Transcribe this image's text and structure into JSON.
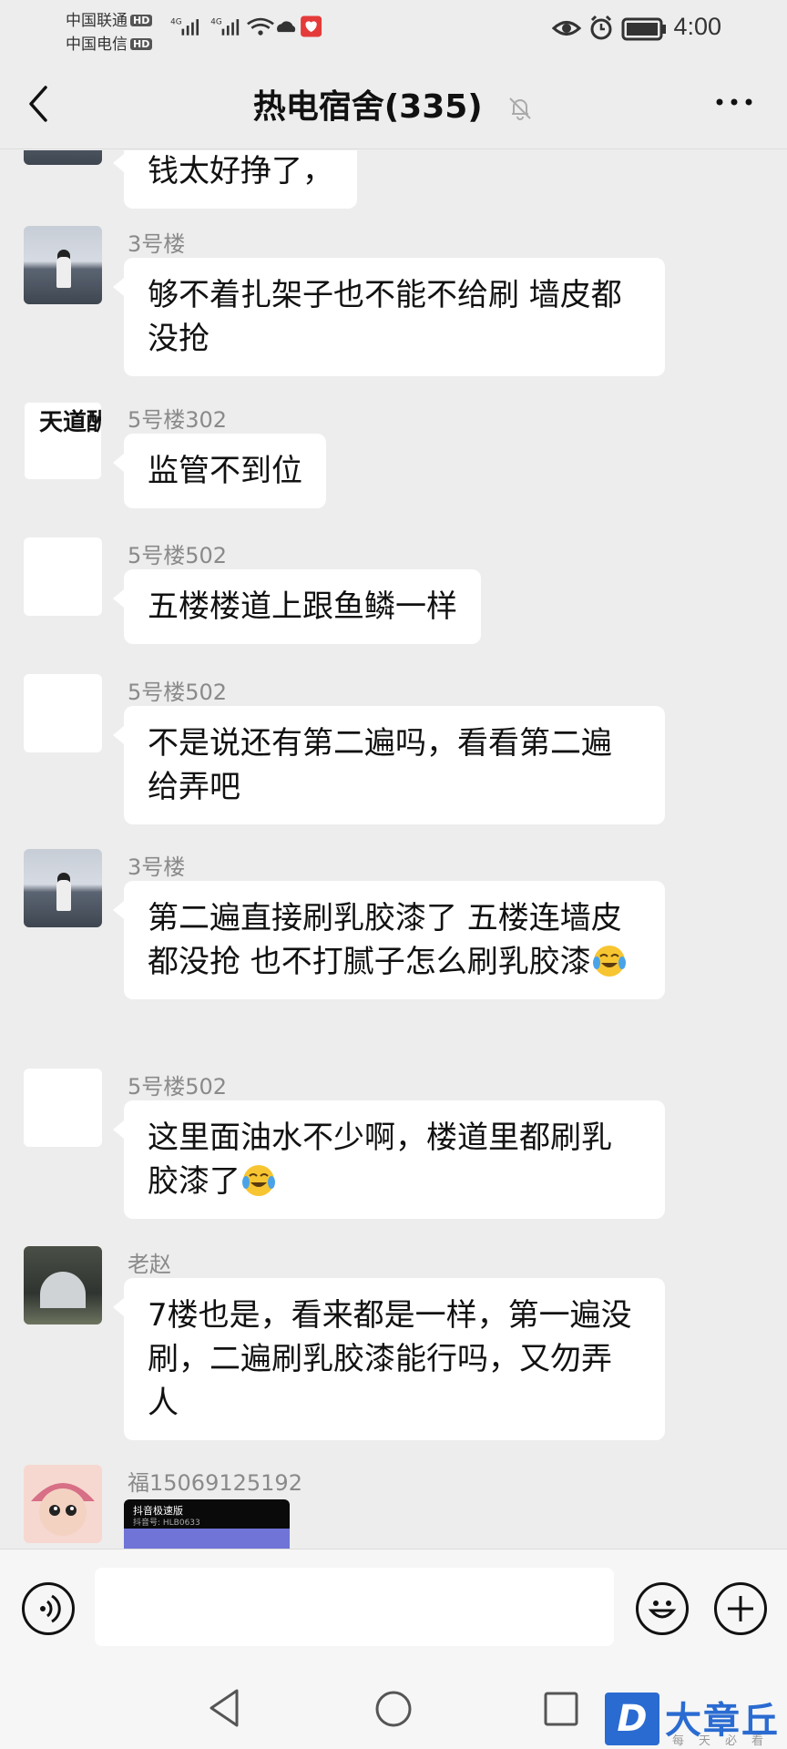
{
  "status_bar": {
    "carrier1": "中国联通",
    "carrier2": "中国电信",
    "hd": "HD",
    "network": "4G",
    "time": "4:00"
  },
  "header": {
    "title": "热电宿舍(335)"
  },
  "messages": [
    {
      "sender": "",
      "text": "钱太好挣了，"
    },
    {
      "sender": "3号楼",
      "text": "够不着扎架子也不能不给刷 墙皮都没抢"
    },
    {
      "sender": "5号楼302",
      "text": "监管不到位"
    },
    {
      "sender": "5号楼502",
      "text": "五楼楼道上跟鱼鳞一样"
    },
    {
      "sender": "5号楼502",
      "text": "不是说还有第二遍吗，看看第二遍给弄吧"
    },
    {
      "sender": "3号楼",
      "text": "第二遍直接刷乳胶漆了 五楼连墙皮都没抢 也不打腻子怎么刷乳胶漆"
    },
    {
      "sender": "5号楼502",
      "text": "这里面油水不少啊，楼道里都刷乳胶漆了"
    },
    {
      "sender": "老赵",
      "text": "7楼也是，看来都是一样，第一遍没刷，二遍刷乳胶漆能行吗，又勿弄人"
    },
    {
      "sender": "福15069125192",
      "video_title": "抖音极速版",
      "video_sub": "抖音号: HLB0633"
    }
  ],
  "avatar_calligraphy": "天道酬勤",
  "watermark": {
    "brand": "大章丘",
    "tagline": "每天必看",
    "logo_letter": "D"
  },
  "icons": {
    "back": "chevron-left-icon",
    "mute": "bell-off-icon",
    "more": "more-dots-icon",
    "voice": "voice-icon",
    "emoji": "smiley-icon",
    "plus": "plus-icon",
    "crying_laugh": "crying-laugh-emoji"
  }
}
